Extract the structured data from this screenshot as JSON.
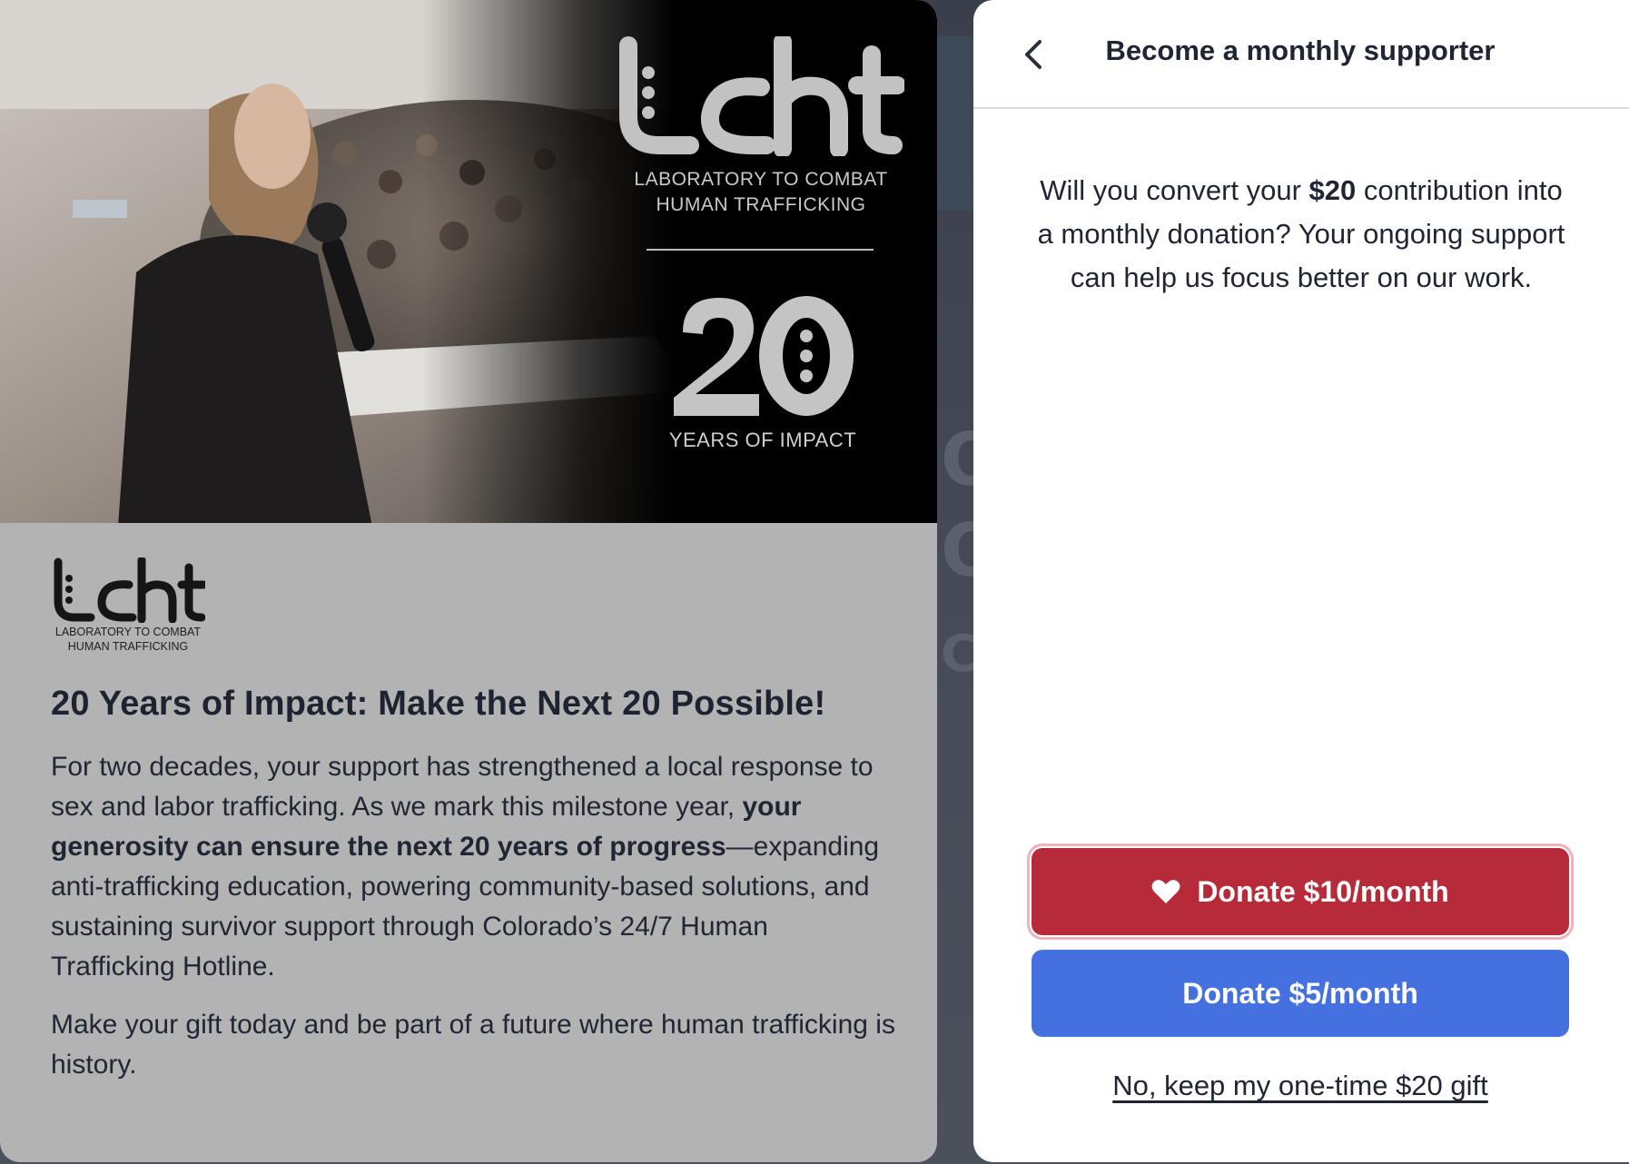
{
  "campaign": {
    "hero": {
      "logo_wordmark": "lcht",
      "org_name_line1": "LABORATORY TO COMBAT",
      "org_name_line2": "HUMAN TRAFFICKING",
      "years_number": "20",
      "years_caption": "YEARS OF IMPACT"
    },
    "small_logo": {
      "wordmark": "lcht",
      "name_line1": "LABORATORY TO COMBAT",
      "name_line2": "HUMAN TRAFFICKING"
    },
    "title": "20 Years of Impact: Make the Next 20 Possible!",
    "paragraph1_start": "For two decades, your support has strengthened a local response to sex and labor trafficking. As we mark this milestone year, ",
    "paragraph1_bold": "your generosity can ensure the next 20 years of progress",
    "paragraph1_end": "—expanding anti-trafficking education, powering community-based solutions, and sustaining survivor support through Colorado’s 24/7 Human Trafficking Hotline.",
    "paragraph2": "Make your gift today and be part of a future where human trafficking is history."
  },
  "modal": {
    "back_icon": "chevron-left-icon",
    "title": "Become a monthly supporter",
    "message_start": "Will you convert your ",
    "message_amount": "$20",
    "message_end": " contribution into a monthly donation? Your ongoing support can help us focus better on our work.",
    "primary_button": {
      "icon": "heart-icon",
      "label": "Donate $10/month"
    },
    "secondary_button": {
      "label": "Donate $5/month"
    },
    "decline_link": "No, keep my one-time $20 gift"
  },
  "colors": {
    "primary_button": "#b62a3a",
    "secondary_button": "#4470e0",
    "card_background": "#b3b3b3",
    "modal_background": "#ffffff"
  }
}
